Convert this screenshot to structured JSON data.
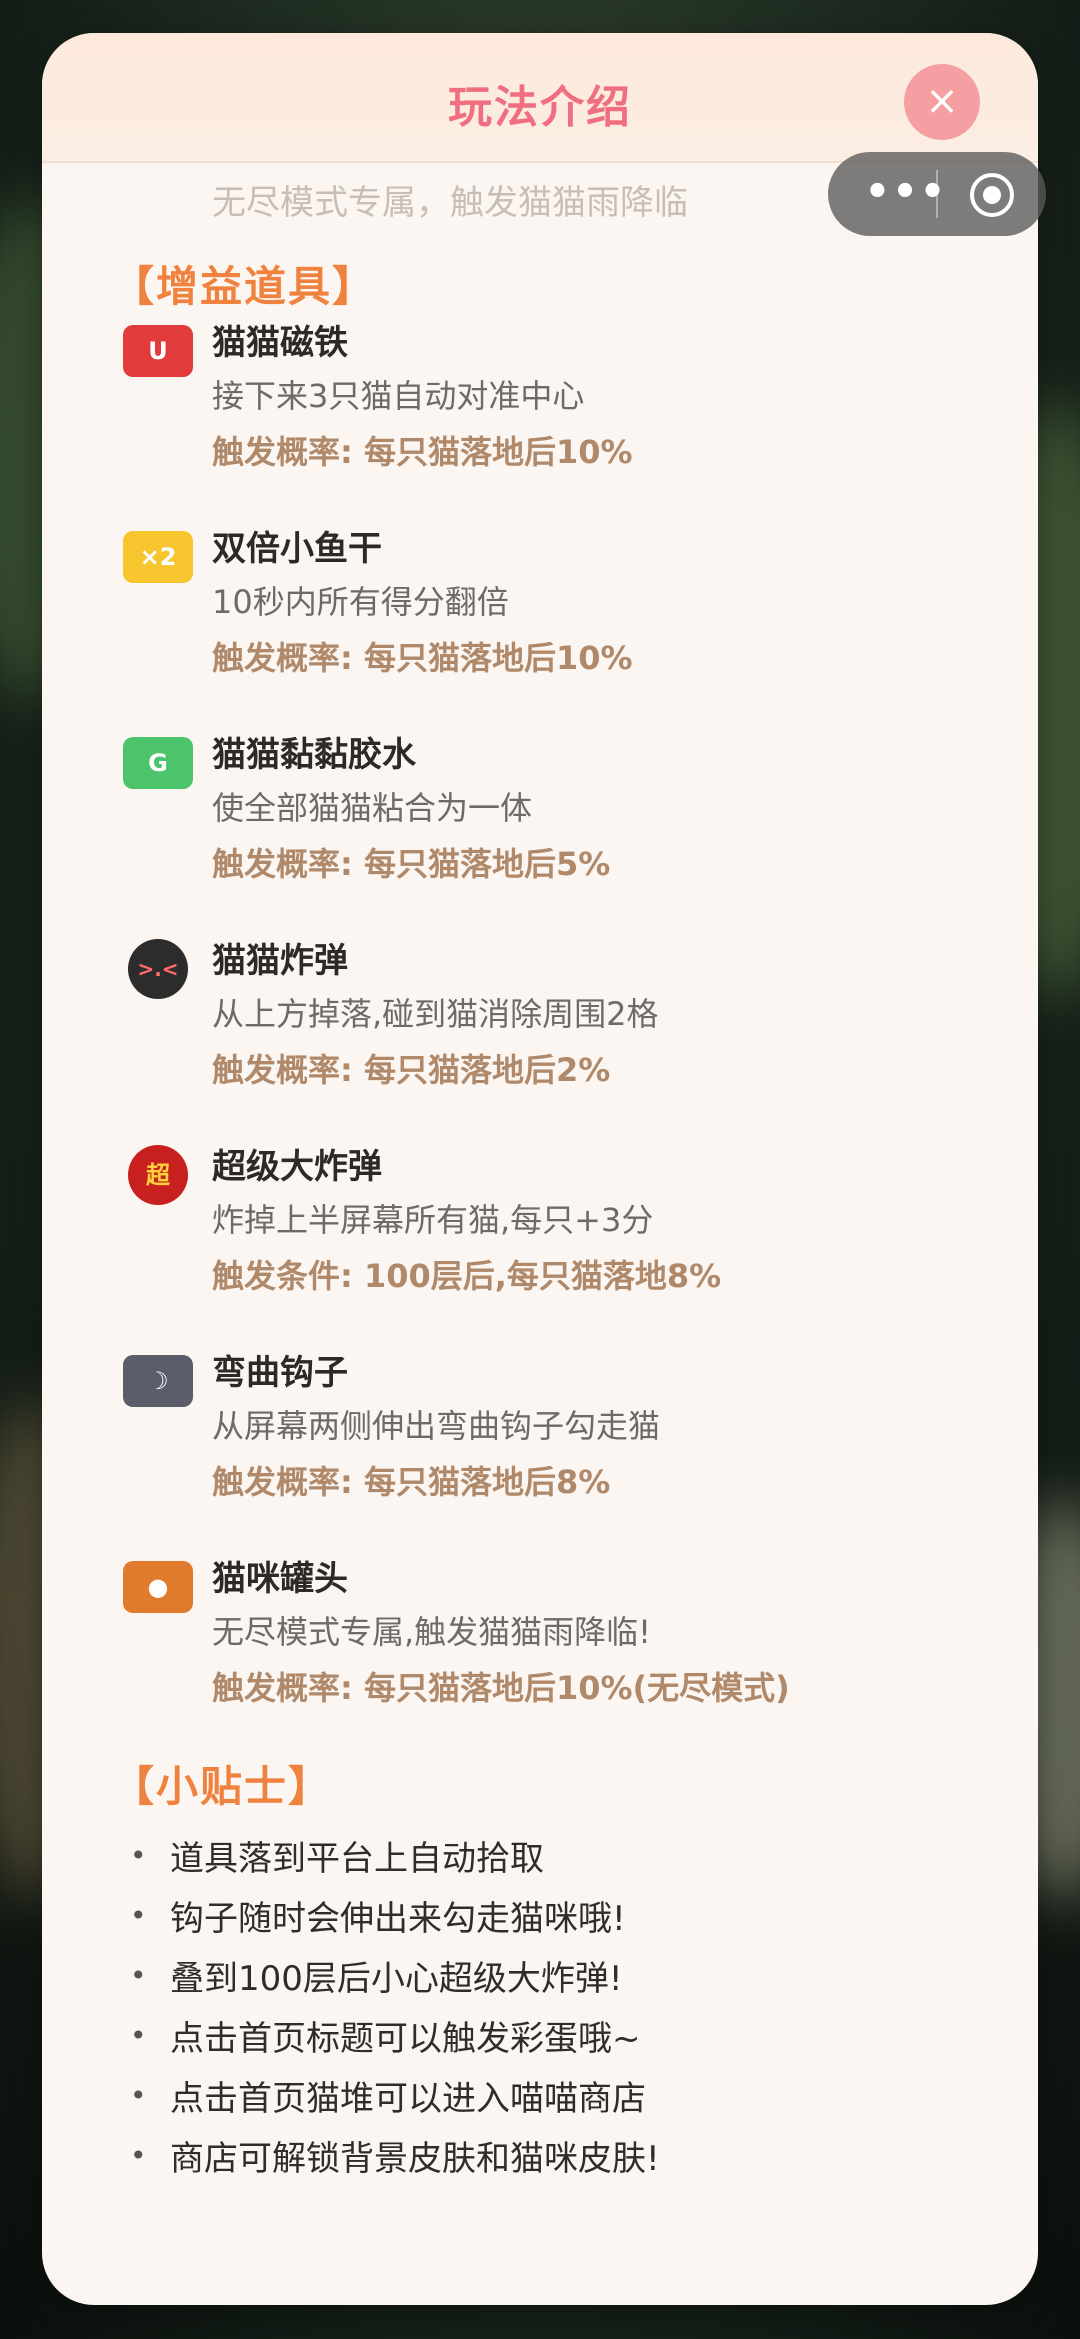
{
  "title": "玩法介绍",
  "close_label": "×",
  "peek_text": "无尽模式专属，触发猫猫雨降临",
  "miniprogram_capsule": {
    "more_label": "•••",
    "icons": [
      "more-dots-icon",
      "target-exit-icon"
    ]
  },
  "boosters": {
    "heading": "【增益道具】",
    "items": [
      {
        "icon": "U",
        "icon_name": "magnet-icon",
        "color": "#e23b3b",
        "name": "猫猫磁铁",
        "desc": "接下来3只猫自动对准中心",
        "rate": "触发概率: 每只猫落地后10%"
      },
      {
        "icon": "×2",
        "icon_name": "double-fish-icon",
        "color": "#f7c62f",
        "name": "双倍小鱼干",
        "desc": "10秒内所有得分翻倍",
        "rate": "触发概率: 每只猫落地后10%"
      },
      {
        "icon": "G",
        "icon_name": "glue-icon",
        "color": "#4cc46b",
        "name": "猫猫黏黏胶水",
        "desc": "使全部猫猫粘合为一体",
        "rate": "触发概率: 每只猫落地后5%"
      },
      {
        "icon": ">.<",
        "icon_name": "bomb-icon",
        "color": "#2c2c2c",
        "name": "猫猫炸弹",
        "desc": "从上方掉落,碰到猫消除周围2格",
        "rate": "触发概率: 每只猫落地后2%"
      },
      {
        "icon": "超",
        "icon_name": "super-bomb-icon",
        "color": "#c8201e",
        "name": "超级大炸弹",
        "desc": "炸掉上半屏幕所有猫,每只+3分",
        "rate": "触发条件: 100层后,每只猫落地8%"
      },
      {
        "icon": "☽",
        "icon_name": "hook-icon",
        "color": "#5b5d6b",
        "name": "弯曲钩子",
        "desc": "从屏幕两侧伸出弯曲钩子勾走猫",
        "rate": "触发概率: 每只猫落地后8%"
      },
      {
        "icon": "●",
        "icon_name": "cat-can-icon",
        "color": "#e07a2c",
        "name": "猫咪罐头",
        "desc": "无尽模式专属,触发猫猫雨降临!",
        "rate": "触发概率: 每只猫落地后10%(无尽模式)"
      }
    ]
  },
  "tips": {
    "heading": "【小贴士】",
    "bullet": "•",
    "items": [
      "道具落到平台上自动拾取",
      "钩子随时会伸出来勾走猫咪哦!",
      "叠到100层后小心超级大炸弹!",
      "点击首页标题可以触发彩蛋哦~",
      "点击首页猫堆可以进入喵喵商店",
      "商店可解锁背景皮肤和猫咪皮肤!"
    ]
  }
}
